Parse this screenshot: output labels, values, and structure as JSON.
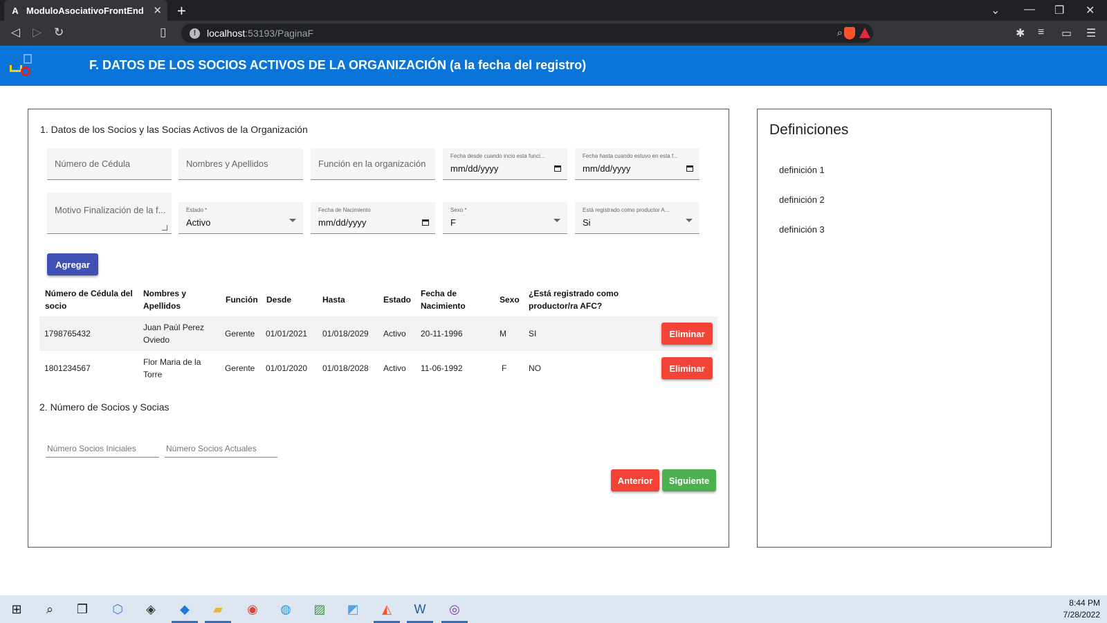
{
  "browser": {
    "tab_title": "ModuloAsociativoFrontEnd",
    "tab_icon": "A",
    "url_host": "localhost",
    "url_path": ":53193/PaginaF"
  },
  "header": {
    "title": "F. DATOS DE LOS SOCIOS ACTIVOS DE LA ORGANIZACIÓN (a la fecha del registro)"
  },
  "section1": {
    "title": "1. Datos de los Socios y las Socias Activos de la Organización",
    "fields": {
      "cedula": "Número de Cédula",
      "nombres": "Nombres y Apellidos",
      "funcion": "Función en la organización",
      "fecha_desde_label": "Fecha desde cuando incio esta funci...",
      "fecha_desde_value": "mm/dd/yyyy",
      "fecha_hasta_label": "Fecha hasta cuando estuvo en esta f...",
      "fecha_hasta_value": "mm/dd/yyyy",
      "motivo": "Motivo Finalización de la f...",
      "estado_label": "Estado *",
      "estado_value": "Activo",
      "nacimiento_label": "Fecha de Nacimiento",
      "nacimiento_value": "mm/dd/yyyy",
      "sexo_label": "Sexo *",
      "sexo_value": "F",
      "productor_label": "Está registrado como productor A...",
      "productor_value": "Si"
    },
    "add_button": "Agregar",
    "table": {
      "headers": {
        "cedula": "Número de Cédula del socio",
        "nombres": "Nombres y Apellidos",
        "funcion": "Función",
        "desde": "Desde",
        "hasta": "Hasta",
        "estado": "Estado",
        "nacimiento": "Fecha de Nacimiento",
        "sexo": "Sexo",
        "afc": "¿Está registrado como productor/ra AFC?"
      },
      "rows": [
        {
          "cedula": "1798765432",
          "nombres": "Juan Paúl Perez Oviedo",
          "funcion": "Gerente",
          "desde": "01/01/2021",
          "hasta": "01/018/2029",
          "estado": "Activo",
          "nacimiento": "20-11-1996",
          "sexo": "M",
          "afc": "SI",
          "action": "Eliminar"
        },
        {
          "cedula": "1801234567",
          "nombres": "Flor Maria de la Torre",
          "funcion": "Gerente",
          "desde": "01/01/2020",
          "hasta": "01/018/2028",
          "estado": "Activo",
          "nacimiento": "11-06-1992",
          "sexo": "F",
          "afc": "NO",
          "action": "Eliminar"
        }
      ]
    }
  },
  "section2": {
    "title": "2. Número de Socios y Socias",
    "iniciales_placeholder": "Número Socios Iniciales",
    "actuales_placeholder": "Número Socios Actuales"
  },
  "nav": {
    "prev": "Anterior",
    "next": "Siguiente"
  },
  "definitions": {
    "title": "Definiciones",
    "items": [
      "definición 1",
      "definición 2",
      "definición 3"
    ]
  },
  "taskbar": {
    "time": "8:44 PM",
    "date": "7/28/2022"
  },
  "colors": {
    "appbar": "#0b74d9",
    "primary_button": "#3f51b5",
    "danger_button": "#f44336",
    "success_button": "#4caf50"
  }
}
